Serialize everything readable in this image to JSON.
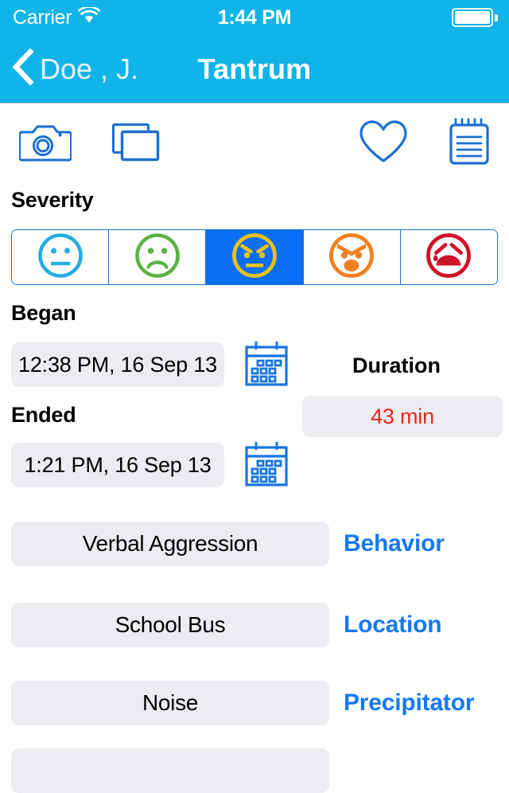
{
  "status_bar": {
    "carrier": "Carrier",
    "wifi_icon": "wifi-icon",
    "time": "1:44 PM",
    "battery_icon": "battery-full-icon"
  },
  "nav": {
    "back_icon": "chevron-left-icon",
    "back_label": "Doe , J.",
    "title": "Tantrum"
  },
  "toolbar": {
    "camera": {
      "icon": "camera-icon",
      "label": "Camera"
    },
    "photos": {
      "icon": "photo-stack-icon",
      "label": "Photos"
    },
    "favorite": {
      "icon": "heart-icon",
      "label": "Favorite"
    },
    "notes": {
      "icon": "notepad-icon",
      "label": "Notes"
    }
  },
  "severity": {
    "label": "Severity",
    "selected_index": 2,
    "options": [
      {
        "name": "neutral-face",
        "color": "#23AEE5",
        "level": 1
      },
      {
        "name": "sad-face",
        "color": "#5CB martins",
        "level": 2
      },
      {
        "name": "angry-face",
        "color": "#E8C21C",
        "level": 3
      },
      {
        "name": "very-angry-face",
        "color": "#F08020",
        "level": 4
      },
      {
        "name": "crying-face",
        "color": "#CE1226",
        "level": 5
      }
    ]
  },
  "began": {
    "label": "Began",
    "value": "12:38 PM, 16 Sep 13",
    "calendar_icon": "calendar-icon"
  },
  "ended": {
    "label": "Ended",
    "value": "1:21 PM, 16 Sep 13",
    "calendar_icon": "calendar-icon"
  },
  "duration": {
    "label": "Duration",
    "value": "43 min",
    "color": "#E8271A"
  },
  "fields": [
    {
      "value": "Verbal Aggression",
      "label": "Behavior"
    },
    {
      "value": "School Bus",
      "label": "Location"
    },
    {
      "value": "Noise",
      "label": "Precipitator"
    }
  ],
  "colors": {
    "status_bar": "#10B4E8",
    "nav_bar": "#10B4E8",
    "accent_blue": "#1579F0",
    "icon_blue": "#1175D6",
    "pill_bg": "#ECECF1",
    "selected_bg": "#0B6EF4"
  }
}
